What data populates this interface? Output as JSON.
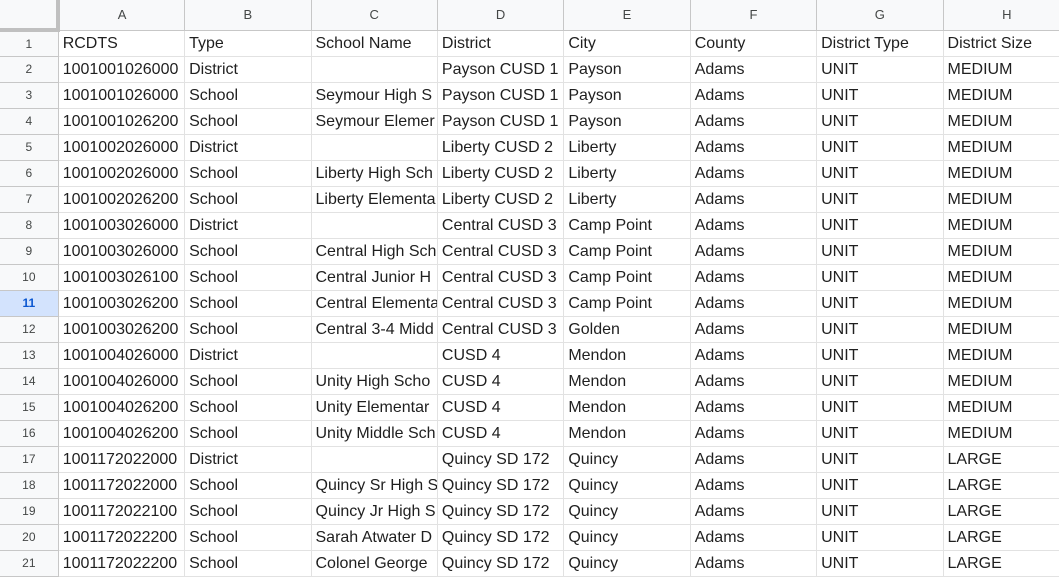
{
  "columns": [
    "A",
    "B",
    "C",
    "D",
    "E",
    "F",
    "G",
    "H"
  ],
  "active_row": 11,
  "rows": [
    {
      "num": "1",
      "cells": [
        "RCDTS",
        "Type",
        "School Name",
        "District",
        "City",
        "County",
        "District Type",
        "District Size"
      ]
    },
    {
      "num": "2",
      "cells": [
        "1001001026000",
        "District",
        "",
        "Payson CUSD 1",
        "Payson",
        "Adams",
        "UNIT",
        "MEDIUM"
      ]
    },
    {
      "num": "3",
      "cells": [
        "1001001026000",
        "School",
        "Seymour High S",
        "Payson CUSD 1",
        "Payson",
        "Adams",
        "UNIT",
        "MEDIUM"
      ]
    },
    {
      "num": "4",
      "cells": [
        "1001001026200",
        "School",
        "Seymour Elemer",
        "Payson CUSD 1",
        "Payson",
        "Adams",
        "UNIT",
        "MEDIUM"
      ]
    },
    {
      "num": "5",
      "cells": [
        "1001002026000",
        "District",
        "",
        "Liberty CUSD 2",
        "Liberty",
        "Adams",
        "UNIT",
        "MEDIUM"
      ]
    },
    {
      "num": "6",
      "cells": [
        "1001002026000",
        "School",
        "Liberty High Sch",
        "Liberty CUSD 2",
        "Liberty",
        "Adams",
        "UNIT",
        "MEDIUM"
      ]
    },
    {
      "num": "7",
      "cells": [
        "1001002026200",
        "School",
        "Liberty Elementa",
        "Liberty CUSD 2",
        "Liberty",
        "Adams",
        "UNIT",
        "MEDIUM"
      ]
    },
    {
      "num": "8",
      "cells": [
        "1001003026000",
        "District",
        "",
        "Central CUSD 3",
        "Camp Point",
        "Adams",
        "UNIT",
        "MEDIUM"
      ]
    },
    {
      "num": "9",
      "cells": [
        "1001003026000",
        "School",
        "Central High Sch",
        "Central CUSD 3",
        "Camp Point",
        "Adams",
        "UNIT",
        "MEDIUM"
      ]
    },
    {
      "num": "10",
      "cells": [
        "1001003026100",
        "School",
        "Central Junior H",
        "Central CUSD 3",
        "Camp Point",
        "Adams",
        "UNIT",
        "MEDIUM"
      ]
    },
    {
      "num": "11",
      "cells": [
        "1001003026200",
        "School",
        "Central Elementa",
        "Central CUSD 3",
        "Camp Point",
        "Adams",
        "UNIT",
        "MEDIUM"
      ]
    },
    {
      "num": "12",
      "cells": [
        "1001003026200",
        "School",
        "Central 3-4 Midd",
        "Central CUSD 3",
        "Golden",
        "Adams",
        "UNIT",
        "MEDIUM"
      ]
    },
    {
      "num": "13",
      "cells": [
        "1001004026000",
        "District",
        "",
        "CUSD 4",
        "Mendon",
        "Adams",
        "UNIT",
        "MEDIUM"
      ]
    },
    {
      "num": "14",
      "cells": [
        "1001004026000",
        "School",
        "Unity High Scho",
        "CUSD 4",
        "Mendon",
        "Adams",
        "UNIT",
        "MEDIUM"
      ]
    },
    {
      "num": "15",
      "cells": [
        "1001004026200",
        "School",
        "Unity Elementar",
        "CUSD 4",
        "Mendon",
        "Adams",
        "UNIT",
        "MEDIUM"
      ]
    },
    {
      "num": "16",
      "cells": [
        "1001004026200",
        "School",
        "Unity Middle Sch",
        "CUSD 4",
        "Mendon",
        "Adams",
        "UNIT",
        "MEDIUM"
      ]
    },
    {
      "num": "17",
      "cells": [
        "1001172022000",
        "District",
        "",
        "Quincy SD 172",
        "Quincy",
        "Adams",
        "UNIT",
        "LARGE"
      ]
    },
    {
      "num": "18",
      "cells": [
        "1001172022000",
        "School",
        "Quincy Sr High S",
        "Quincy SD 172",
        "Quincy",
        "Adams",
        "UNIT",
        "LARGE"
      ]
    },
    {
      "num": "19",
      "cells": [
        "1001172022100",
        "School",
        "Quincy Jr High S",
        "Quincy SD 172",
        "Quincy",
        "Adams",
        "UNIT",
        "LARGE"
      ]
    },
    {
      "num": "20",
      "cells": [
        "1001172022200",
        "School",
        "Sarah Atwater D",
        "Quincy SD 172",
        "Quincy",
        "Adams",
        "UNIT",
        "LARGE"
      ]
    },
    {
      "num": "21",
      "cells": [
        "1001172022200",
        "School",
        "Colonel George",
        "Quincy SD 172",
        "Quincy",
        "Adams",
        "UNIT",
        "LARGE"
      ]
    }
  ]
}
